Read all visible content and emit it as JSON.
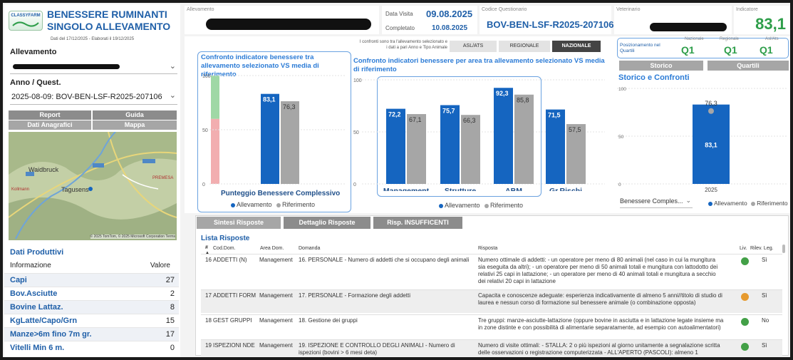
{
  "header": {
    "logo_text": "CLASSYFARM",
    "title_line1": "BENESSERE RUMINANTI",
    "title_line2": "SINGOLO ALLEVAMENTO",
    "data_note": "Dati del 17/12/2025 - Elaborati il 19/12/2025"
  },
  "filters": {
    "allevamento_label": "Allevamento",
    "anno_label": "Anno / Quest.",
    "anno_value": "2025-08-09: BOV-BEN-LSF-R2025-207106"
  },
  "nav_buttons": {
    "report": "Report",
    "guida": "Guida",
    "dati_anagrafici": "Dati Anagrafici",
    "mappa": "Mappa"
  },
  "map": {
    "places": [
      "Waidbruck",
      "Tagusens",
      "PREMESA",
      "Kollmann"
    ],
    "attribution": "© 2025 TomTom, © 2025 Microsoft Corporation  Terms"
  },
  "produttivi": {
    "title": "Dati Produttivi",
    "col_info": "Informazione",
    "col_valore": "Valore",
    "rows": [
      {
        "label": "Capi",
        "value": "27"
      },
      {
        "label": "Bov.Asciutte",
        "value": "2"
      },
      {
        "label": "Bovine Lattaz.",
        "value": "8"
      },
      {
        "label": "KgLatte/Capo/Grn",
        "value": "15"
      },
      {
        "label": "Manze>6m fino 7m gr.",
        "value": "17"
      },
      {
        "label": "Vitelli Min 6 m.",
        "value": "0"
      }
    ]
  },
  "top_info": {
    "allevamento_caption": "Allevamento",
    "data_visita_label": "Data Visita",
    "data_visita": "09.08.2025",
    "completato_label": "Completato",
    "completato": "10.08.2025",
    "codice_caption": "Codice Questionario",
    "codice": "BOV-BEN-LSF-R2025-207106",
    "veterinario_caption": "Veterinario",
    "indicatore_caption": "Indicatore",
    "indicatore": "83,1"
  },
  "confronti": {
    "note_line1": "I confronti sono tra l'allevamento selezionato e",
    "note_line2": "i dati a pari Anno e Tipo Animale",
    "buttons": [
      "ASL/ATS",
      "REGIONALE",
      "NAZIONALE"
    ],
    "selected": "NAZIONALE"
  },
  "quartili": {
    "label": "Posizionamento nel Quartili",
    "headers": [
      "Nazionale",
      "Regionale",
      "Asl/Ats"
    ],
    "values": [
      "Q1",
      "Q1",
      "Q1"
    ],
    "btn_storico": "Storico",
    "btn_quartili": "Quartili"
  },
  "colors": {
    "allevamento": "#1565c0",
    "riferimento": "#a6a6a6",
    "green": "#2e9e4a",
    "accent_blue": "#1f5fa8"
  },
  "chart_data": [
    {
      "type": "bar",
      "title": "Confronto indicatore benessere tra allevamento selezionato VS media di riferimento",
      "categories": [
        "Punteggio Benessere Complessivo"
      ],
      "series": [
        {
          "name": "Allevamento",
          "values": [
            83.1
          ]
        },
        {
          "name": "Riferimento",
          "values": [
            76.3
          ]
        }
      ],
      "ylim": [
        0,
        100
      ],
      "yticks": [
        "0",
        "50",
        "100"
      ],
      "value_labels": {
        "allevamento": [
          "83,1"
        ],
        "riferimento": [
          "76,3"
        ]
      },
      "legend": [
        "Allevamento",
        "Riferimento"
      ]
    },
    {
      "type": "bar",
      "title": "Confronto indicatori benessere per area tra allevamento selezionato VS media di riferimento",
      "categories": [
        "Management",
        "Strutture",
        "ABM",
        "Gr.Rischi"
      ],
      "series": [
        {
          "name": "Allevamento",
          "values": [
            72.2,
            75.7,
            92.3,
            71.5
          ]
        },
        {
          "name": "Riferimento",
          "values": [
            67.1,
            66.3,
            85.8,
            57.5
          ]
        }
      ],
      "ylim": [
        0,
        100
      ],
      "yticks": [
        "0",
        "50",
        "100"
      ],
      "value_labels": {
        "allevamento": [
          "72,2",
          "75,7",
          "92,3",
          "71,5"
        ],
        "riferimento": [
          "67,1",
          "66,3",
          "85,8",
          "57,5"
        ]
      },
      "legend": [
        "Allevamento",
        "Riferimento"
      ]
    },
    {
      "type": "bar",
      "title": "Storico e Confronti",
      "categories": [
        "2025"
      ],
      "series": [
        {
          "name": "Allevamento",
          "values": [
            83.1
          ]
        },
        {
          "name": "Riferimento",
          "values": [
            76.3
          ]
        }
      ],
      "ylim": [
        0,
        100
      ],
      "yticks": [
        "0",
        "50",
        "100"
      ],
      "value_labels": {
        "allevamento": [
          "83,1"
        ],
        "riferimento": [
          "76,3"
        ]
      },
      "dropdown": "Benessere Comples...",
      "legend": [
        "Allevamento",
        "Riferimento"
      ]
    }
  ],
  "risposte": {
    "tabs": [
      "Sintesi Risposte",
      "Dettaglio Risposte",
      "Risp. INSUFFICENTI"
    ],
    "list_title": "Lista Risposte",
    "headers": [
      "#",
      "Cod.Dom.",
      "Area Dom.",
      "Domanda",
      "Risposta",
      "Liv.",
      "Rilev. Leg."
    ],
    "rows": [
      {
        "n": "16",
        "cod": "ADDETTI (N)",
        "area": "Management",
        "domanda": "16. PERSONALE - Numero di addetti che si occupano degli animali",
        "risposta": "Numero ottimale di addetti: - un operatore per meno di 80 animali (nel caso in cui la mungitura sia eseguita da altri); - un operatore per meno di 50 animali totali e mungitura con lattodotto dei relativi 25 capi in lattazione; - un operatore per meno di 40 animali totali e mungitura a secchio dei relativi 20 capi in lattazione",
        "liv_color": "#43a047",
        "rilev": "Sì"
      },
      {
        "n": "17",
        "cod": "ADDETTI FORM",
        "area": "Management",
        "domanda": "17. PERSONALE - Formazione degli addetti",
        "risposta": "Capacita e conoscenze adeguate: esperienza indicativamente di almeno 5 anni//titolo di studio di laurea e nessun corso di formazione sul benessere animale (o combinazione opposta)",
        "liv_color": "#e69a2e",
        "rilev": "Sì"
      },
      {
        "n": "18",
        "cod": "GEST GRUPPI",
        "area": "Management",
        "domanda": "18. Gestione dei gruppi",
        "risposta": "Tre gruppi: manze-asciutte-lattazione (oppure bovine in asciutta e in lattazione legate insieme ma in zone distinte e con possibilità di alimentarie separatamente, ad esempio con autoalimentatori)",
        "liv_color": "#43a047",
        "rilev": "No"
      },
      {
        "n": "19",
        "cod": "ISPEZIONI NDE",
        "area": "Management",
        "domanda": "19. ISPEZIONE E CONTROLLO DEGLI ANIMALI - Numero di ispezioni (bovini > 6 mesi deta)",
        "risposta": "Numero di visite ottimali: - STALLA: 2 o più ispezioni al giorno unitamente a segnalazione scritta delle osservazioni o registrazione computerizzata - ALL'APERTO (PASCOLI): almeno 1",
        "liv_color": "#43a047",
        "rilev": "Sì"
      }
    ]
  }
}
